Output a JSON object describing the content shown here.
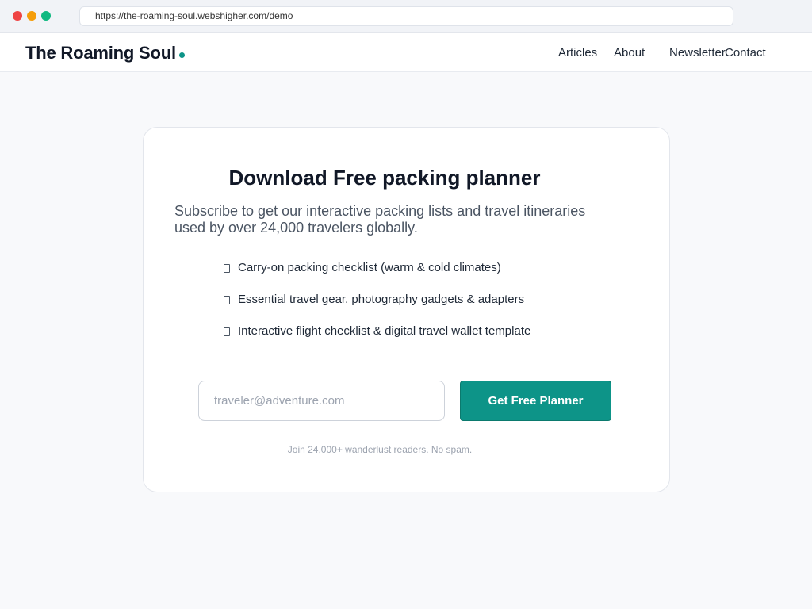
{
  "browser": {
    "url": "https://the-roaming-soul.webshigher.com/demo",
    "traffic_lights": {
      "close_color": "#ef4444",
      "minimize_color": "#f59e0b",
      "maximize_color": "#10b981"
    }
  },
  "header": {
    "logo_text": "The Roaming Soul",
    "logo_dot_color": "#0d9488",
    "nav": [
      {
        "label": "Articles"
      },
      {
        "label": "About"
      },
      {
        "label": "Newsletter"
      },
      {
        "label": "Contact"
      }
    ]
  },
  "card": {
    "title": "Download Free packing planner",
    "subtitle": "Subscribe to get our interactive packing lists and travel itineraries used by over 24,000 travelers globally.",
    "features": [
      {
        "icon": "checkbox-icon",
        "text": "Carry-on packing checklist (warm & cold climates)"
      },
      {
        "icon": "checkbox-icon",
        "text": "Essential travel gear, photography gadgets & adapters"
      },
      {
        "icon": "checkbox-icon",
        "text": "Interactive flight checklist & digital travel wallet template"
      }
    ],
    "email_placeholder": "traveler@adventure.com",
    "email_value": "",
    "button_label": "Get Free Planner",
    "button_color": "#0d9488",
    "disclaimer": "Join 24,000+ wanderlust readers. No spam."
  }
}
